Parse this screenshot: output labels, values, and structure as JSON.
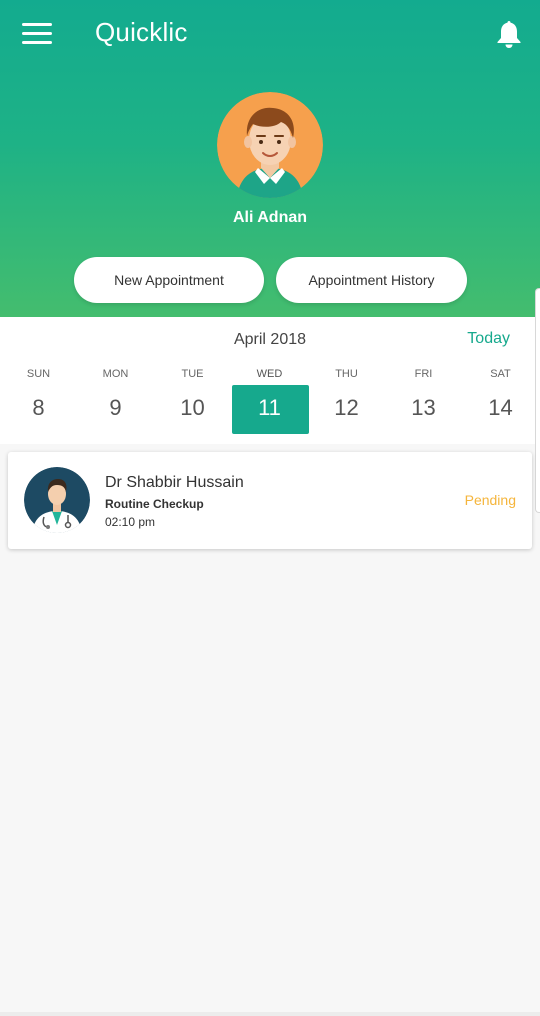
{
  "app": {
    "title": "Quicklic"
  },
  "icons": {
    "menu": "hamburger-menu-icon",
    "notifications": "bell-icon"
  },
  "profile": {
    "name": "Ali Adnan"
  },
  "actions": {
    "new_appointment": "New Appointment",
    "appointment_history": "Appointment History"
  },
  "calendar": {
    "month_label": "April 2018",
    "today_label": "Today",
    "selected_day": "11",
    "days": [
      {
        "name": "SUN",
        "num": "8"
      },
      {
        "name": "MON",
        "num": "9"
      },
      {
        "name": "TUE",
        "num": "10"
      },
      {
        "name": "WED",
        "num": "11"
      },
      {
        "name": "THU",
        "num": "12"
      },
      {
        "name": "FRI",
        "num": "13"
      },
      {
        "name": "SAT",
        "num": "14"
      }
    ]
  },
  "appointments": [
    {
      "doctor": "Dr Shabbir Hussain",
      "type": "Routine Checkup",
      "time": "02:10 pm",
      "status": "Pending"
    }
  ],
  "colors": {
    "accent": "#16a98d",
    "header_top": "#13ab8f",
    "header_bottom": "#44bd6e",
    "pending": "#f5b53c"
  }
}
